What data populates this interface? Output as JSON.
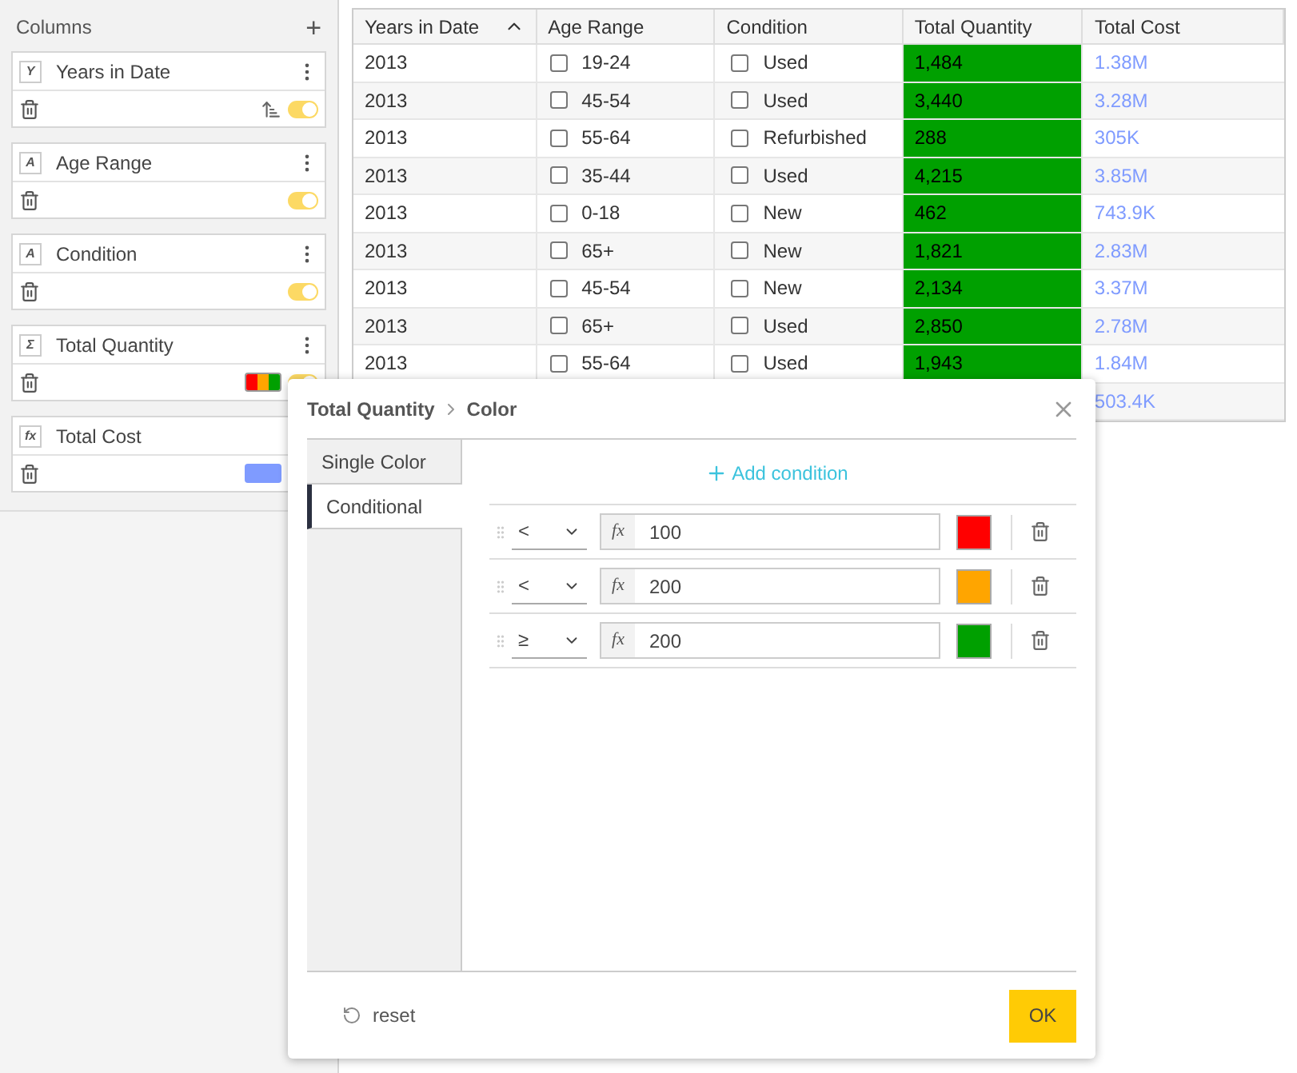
{
  "sidebar": {
    "title": "Columns",
    "add_label": "+",
    "items": [
      {
        "type_label": "Y",
        "name": "Years in Date",
        "menu": true,
        "sorted": true,
        "on": true
      },
      {
        "type_label": "A",
        "name": "Age Range",
        "menu": true,
        "sorted": false,
        "on": true
      },
      {
        "type_label": "A",
        "name": "Condition",
        "menu": true,
        "sorted": false,
        "on": true
      },
      {
        "type_label": "Σ",
        "name": "Total Quantity",
        "menu": true,
        "sorted": false,
        "on": true,
        "kind": "conditional"
      },
      {
        "type_label": "fx",
        "name": "Total Cost",
        "sorted": false,
        "kind": "single",
        "color": "#7f9bff"
      }
    ]
  },
  "table": {
    "columns": [
      "Years in Date",
      "Age Range",
      "Condition",
      "Total Quantity",
      "Total Cost"
    ],
    "rows": [
      {
        "year": "2013",
        "age": "19-24",
        "age_checked": false,
        "condition": "Used",
        "condition_checked": false,
        "quantity": "1,484",
        "cost": "1.38M"
      },
      {
        "year": "2013",
        "age": "45-54",
        "age_checked": false,
        "condition": "Used",
        "condition_checked": false,
        "quantity": "3,440",
        "cost": "3.28M"
      },
      {
        "year": "2013",
        "age": "55-64",
        "age_checked": false,
        "condition": "Refurbished",
        "condition_checked": false,
        "quantity": "288",
        "cost": "305K"
      },
      {
        "year": "2013",
        "age": "35-44",
        "age_checked": false,
        "condition": "Used",
        "condition_checked": false,
        "quantity": "4,215",
        "cost": "3.85M"
      },
      {
        "year": "2013",
        "age": "0-18",
        "age_checked": false,
        "condition": "New",
        "condition_checked": false,
        "quantity": "462",
        "cost": "743.9K"
      },
      {
        "year": "2013",
        "age": "65+",
        "age_checked": false,
        "condition": "New",
        "condition_checked": false,
        "quantity": "1,821",
        "cost": "2.83M"
      },
      {
        "year": "2013",
        "age": "45-54",
        "age_checked": false,
        "condition": "New",
        "condition_checked": false,
        "quantity": "2,134",
        "cost": "3.37M"
      },
      {
        "year": "2013",
        "age": "65+",
        "age_checked": false,
        "condition": "Used",
        "condition_checked": false,
        "quantity": "2,850",
        "cost": "2.78M"
      },
      {
        "year": "2013",
        "age": "55-64",
        "age_checked": false,
        "condition": "Used",
        "condition_checked": false,
        "quantity": "1,943",
        "cost": "1.84M"
      },
      {
        "cost": "503.4K"
      }
    ]
  },
  "dialog": {
    "breadcrumb": [
      "Total Quantity",
      "Color"
    ],
    "tabs": [
      {
        "label": "Single Color",
        "selected": false
      },
      {
        "label": "Conditional",
        "selected": true
      }
    ],
    "add_condition": "Add condition",
    "conditions": [
      {
        "operator": "<",
        "fx": "fx",
        "value": "100",
        "color": "#ff0000"
      },
      {
        "operator": "<",
        "fx": "fx",
        "value": "200",
        "color": "#ffa500"
      },
      {
        "operator": "≥",
        "fx": "fx",
        "value": "200",
        "color": "#00a000"
      }
    ],
    "reset": "reset",
    "ok": "OK"
  }
}
